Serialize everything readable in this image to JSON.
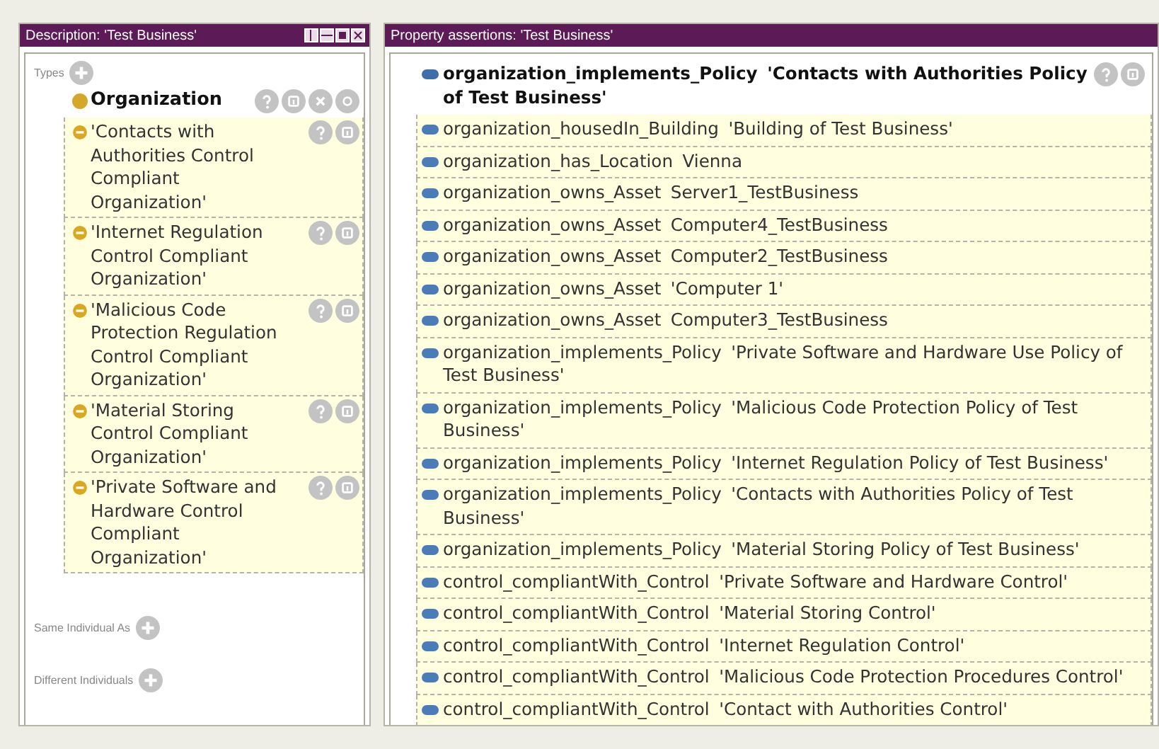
{
  "description_panel": {
    "title": "Description: 'Test Business'",
    "types": {
      "label": "Types",
      "items": [
        {
          "label": "Organization",
          "inferred": false
        },
        {
          "label": "'Contacts with Authorities Control Compliant Organization'",
          "inferred": true
        },
        {
          "label": "'Internet Regulation Control Compliant Organization'",
          "inferred": true
        },
        {
          "label": "'Malicious Code Protection Regulation Control Compliant Organization'",
          "inferred": true
        },
        {
          "label": "'Material Storing Control Compliant Organization'",
          "inferred": true
        },
        {
          "label": "'Private Software and Hardware Control Compliant Organization'",
          "inferred": true
        }
      ]
    },
    "same_individual_as": {
      "label": "Same Individual As"
    },
    "different_individuals": {
      "label": "Different Individuals"
    }
  },
  "property_assertions_panel": {
    "title": "Property assertions: 'Test Business'",
    "assertions": [
      {
        "property": "organization_implements_Policy",
        "value": "'Contacts with Authorities Policy of Test Business'",
        "inferred": false
      },
      {
        "property": "organization_housedIn_Building",
        "value": "'Building of Test Business'",
        "inferred": true
      },
      {
        "property": "organization_has_Location",
        "value": "Vienna",
        "inferred": true
      },
      {
        "property": "organization_owns_Asset",
        "value": "Server1_TestBusiness",
        "inferred": true
      },
      {
        "property": "organization_owns_Asset",
        "value": "Computer4_TestBusiness",
        "inferred": true
      },
      {
        "property": "organization_owns_Asset",
        "value": "Computer2_TestBusiness",
        "inferred": true
      },
      {
        "property": "organization_owns_Asset",
        "value": "'Computer 1'",
        "inferred": true
      },
      {
        "property": "organization_owns_Asset",
        "value": "Computer3_TestBusiness",
        "inferred": true
      },
      {
        "property": "organization_implements_Policy",
        "value": "'Private Software and Hardware Use Policy of Test Business'",
        "inferred": true
      },
      {
        "property": "organization_implements_Policy",
        "value": "'Malicious Code Protection Policy of Test Business'",
        "inferred": true
      },
      {
        "property": "organization_implements_Policy",
        "value": "'Internet Regulation Policy of Test Business'",
        "inferred": true
      },
      {
        "property": "organization_implements_Policy",
        "value": "'Contacts with Authorities Policy of Test Business'",
        "inferred": true
      },
      {
        "property": "organization_implements_Policy",
        "value": "'Material Storing Policy of Test Business'",
        "inferred": true
      },
      {
        "property": "control_compliantWith_Control",
        "value": "'Private Software and Hardware Control'",
        "inferred": true
      },
      {
        "property": "control_compliantWith_Control",
        "value": "'Material Storing Control'",
        "inferred": true
      },
      {
        "property": "control_compliantWith_Control",
        "value": "'Internet Regulation Control'",
        "inferred": true
      },
      {
        "property": "control_compliantWith_Control",
        "value": "'Malicious Code Protection Procedures Control'",
        "inferred": true
      },
      {
        "property": "control_compliantWith_Control",
        "value": "'Contact with Authorities Control'",
        "inferred": true
      }
    ]
  }
}
